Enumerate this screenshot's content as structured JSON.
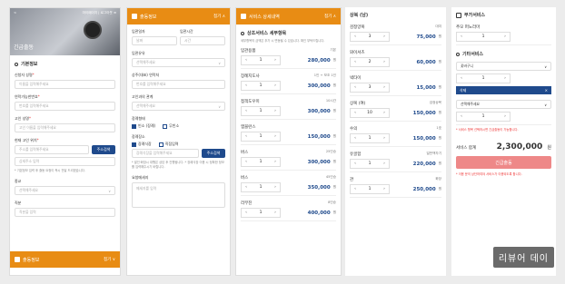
{
  "p1": {
    "top_left": "<",
    "top_links": "마이페이지 | 로그아웃 ≡",
    "hero_text": "긴급출동",
    "basic_section": "기본정보",
    "applicant_label": "신청자 성명",
    "applicant_placeholder": "이름을 입력해주세요",
    "contact_label": "연락가능한번호",
    "contact_placeholder": "번호를 입력해주세요",
    "customer_label": "고인 성명",
    "customer_placeholder": "고인 이름을 입력해주세요",
    "location_label": "현재 고인 위치",
    "location_placeholder": "주소를 입력해주세요",
    "search_btn": "주소검색",
    "detail_placeholder": "상세주소 입력",
    "note": "* 기본정보 입력 후 출동 요청이 즉시 전달 드리겠습니다.",
    "religion_label": "종교",
    "religion_placeholder": "선택해주세요",
    "job_label": "직분",
    "job_placeholder": "직분을 입력",
    "footer_title": "출동정보",
    "footer_fold": "접기 ∨"
  },
  "p2": {
    "header": "출동정보",
    "fold": "접기 ∧",
    "date_label": "입관일자",
    "time_label": "입관시간",
    "date_placeholder": "날짜",
    "time_placeholder": "시간",
    "car_label": "입관유유",
    "car_placeholder": "선택해주세요",
    "sang_label": "상주(대표) 연락처",
    "sang_placeholder": "번호를 입력해주세요",
    "rel_label": "고인과의 관계",
    "rel_placeholder": "선택해주세요",
    "funeral_label": "장례형태",
    "funeral_opt1": "빈소 (장례)",
    "funeral_opt2": "무빈소",
    "place_label": "장례장소",
    "place_opt1": "장례식장",
    "place_opt2": "직접입력",
    "place_placeholder": "장례식장을 입력해주세요",
    "search_btn": "주소검색",
    "notes": "* 발인·화장시 대행은 상담 후 진행됩니다. * 장례식장 이용 시 정확한 정보를 입력해주시기 바랍니다.",
    "req_label": "요청메세지",
    "req_placeholder": "메세지를 입력"
  },
  "p3": {
    "header": "서비스 상세내역",
    "fold": "접기 ∧",
    "section": "상조서비스 세부항목",
    "sub": "세부항목의 금액은 추가 시 변동될 수 있습니다. 확인 부탁드립니다.",
    "items": [
      {
        "name": "입관용품",
        "sub": "기본",
        "qty": "1",
        "price": "280,000"
      },
      {
        "name": "장례지도사",
        "sub": "1인 + 보조 1인",
        "qty": "1",
        "price": "300,000"
      },
      {
        "name": "접객도우미",
        "sub": "10시간",
        "qty": "1",
        "price": "300,000"
      },
      {
        "name": "앰블런스",
        "sub": "",
        "qty": "1",
        "price": "150,000"
      },
      {
        "name": "버스",
        "sub": "25인승",
        "qty": "1",
        "price": "300,000"
      },
      {
        "name": "버스",
        "sub": "45인승",
        "qty": "1",
        "price": "350,000"
      },
      {
        "name": "리무진",
        "sub": "8인승",
        "qty": "1",
        "price": "400,000"
      }
    ],
    "won": "원"
  },
  "p4": {
    "title": "상복 (남)",
    "items": [
      {
        "name": "검정양복",
        "sub": "대여",
        "qty": "3",
        "price": "75,000"
      },
      {
        "name": "와이셔츠",
        "sub": "",
        "qty": "2",
        "price": "60,000"
      },
      {
        "name": "넥타이",
        "sub": "",
        "qty": "3",
        "price": "15,000"
      },
      {
        "name": "상복 (여)",
        "sub": "검정상복",
        "qty": "10",
        "price": "150,000"
      },
      {
        "name": "수의",
        "sub": "1호",
        "qty": "1",
        "price": "150,000"
      },
      {
        "name": "유골함",
        "sub": "일반백자기",
        "qty": "1",
        "price": "220,000"
      },
      {
        "name": "관",
        "sub": "화장",
        "qty": "1",
        "price": "250,000"
      }
    ],
    "won": "원"
  },
  "p5": {
    "extra_title": "부가서비스",
    "extra_label": "추모 퍼노라마",
    "extra_qty": "1",
    "other_title": "기타서비스",
    "flower_label": "꽃바구니",
    "flower_qty": "1",
    "delete_label": "삭제",
    "delete_x": "×",
    "choose_label": "선택해주세요",
    "choose_qty": "1",
    "warn": "* 서비스 항목 선택하시면 긴급출동이 가능합니다.",
    "total_label": "서비스 합계",
    "total_value": "2,300,000",
    "total_unit": "원",
    "submit": "긴급출동",
    "foot_note": "* 이용 문의 상단하여야 서비스가 이용되도록 합니다."
  },
  "watermark": "리뷰어 데이",
  "colors": {
    "orange": "#e88c14",
    "navy": "#1f4a8c",
    "red": "#e33"
  }
}
